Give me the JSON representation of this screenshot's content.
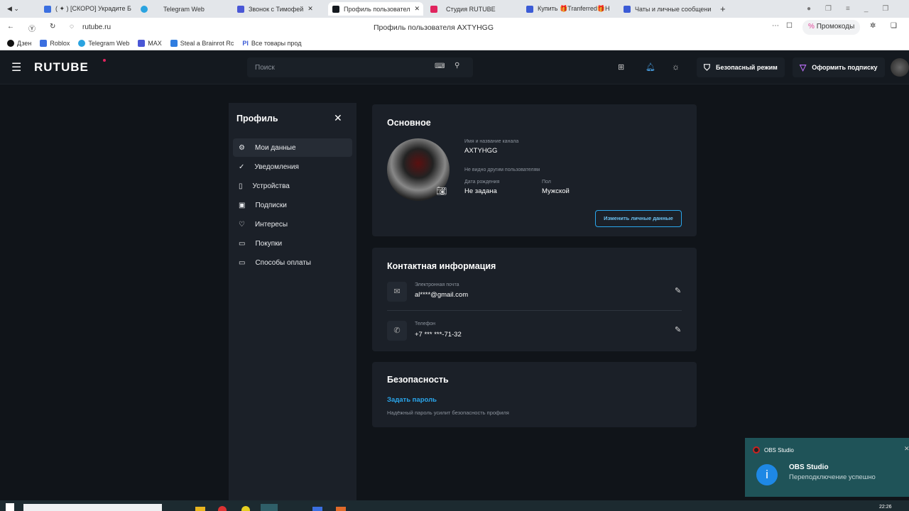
{
  "browser": {
    "tabs": [
      {
        "label": "( ✦ ) [СКОРО] Украдите Б",
        "color": "#3b6fe0"
      },
      {
        "label": "Telegram Web",
        "color": "#2aa3e0"
      },
      {
        "label": "Звонок с Тимофей",
        "color": "#4a57d6"
      },
      {
        "label": "Профиль пользовател",
        "color": "#14191f"
      },
      {
        "label": "Студия RUTUBE",
        "color": "#e0245e"
      },
      {
        "label": "Купить 🎁Tranferred🎁H",
        "color": "#3b5bd6"
      },
      {
        "label": "Чаты и личные сообщени",
        "color": "#3b5bd6"
      }
    ],
    "url": "rutube.ru",
    "page_title": "Профиль пользователя AXTYHGG",
    "promo": "Промокоды",
    "bookmarks": [
      "Дзен",
      "Roblox",
      "Telegram Web",
      "MAX",
      "Steal a Brainrot Rc",
      "Все товары прод"
    ]
  },
  "header": {
    "logo": "RUTUBE",
    "search_placeholder": "Поиск",
    "safe_mode": "Безопасный режим",
    "subscribe": "Оформить подписку"
  },
  "sidebar": {
    "title": "Профиль",
    "items": [
      {
        "label": "Мои данные",
        "icon": "gear-icon"
      },
      {
        "label": "Уведомления",
        "icon": "check-icon"
      },
      {
        "label": "Устройства",
        "icon": "phone-icon"
      },
      {
        "label": "Подписки",
        "icon": "subscriptions-icon"
      },
      {
        "label": "Интересы",
        "icon": "heart-icon"
      },
      {
        "label": "Покупки",
        "icon": "wallet-icon"
      },
      {
        "label": "Способы оплаты",
        "icon": "card-icon"
      }
    ]
  },
  "basic": {
    "title": "Основное",
    "name_label": "Имя и название канала",
    "name": "AXTYHGG",
    "hidden_note": "Не видно другим пользователям",
    "birth_label": "Дата рождения",
    "birth": "Не задана",
    "gender_label": "Пол",
    "gender": "Мужской",
    "edit": "Изменить личные данные"
  },
  "contact": {
    "title": "Контактная информация",
    "email_label": "Электронная почта",
    "email": "al****@gmail.com",
    "phone_label": "Телефон",
    "phone": "+7 *** ***-71-32"
  },
  "security": {
    "title": "Безопасность",
    "set_password": "Задать пароль",
    "hint": "Надёжный пароль усилит безопасность профиля"
  },
  "notification": {
    "app": "OBS Studio",
    "title": "OBS Studio",
    "message": "Переподключение успешно"
  },
  "taskbar": {
    "time": "22:26"
  },
  "colors": {
    "accent": "#2aa6ec",
    "bg": "#101419",
    "card": "#1b2028"
  }
}
